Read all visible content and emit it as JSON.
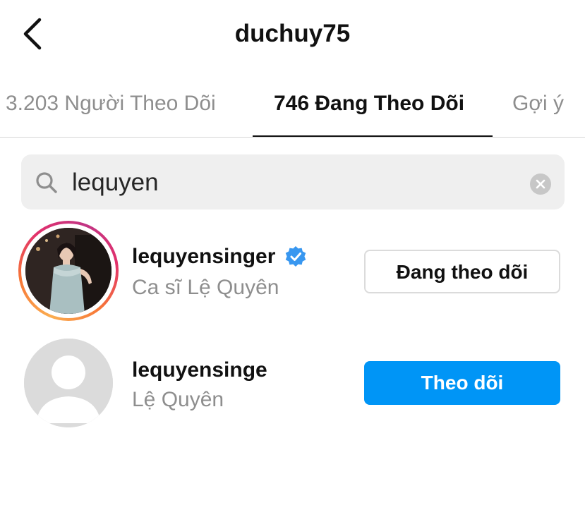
{
  "header": {
    "title": "duchuy75",
    "back_icon": "chevron-left-icon"
  },
  "tabs": [
    {
      "label": "3.203 Người Theo Dõi",
      "active": false
    },
    {
      "label": "746 Đang Theo Dõi",
      "active": true
    },
    {
      "label": "Gợi ý",
      "active": false
    }
  ],
  "search": {
    "value": "lequyen",
    "search_icon": "search-icon",
    "clear_icon": "clear-icon"
  },
  "results": [
    {
      "username": "lequyensinger",
      "fullname": "Ca sĩ Lệ Quyên",
      "verified": true,
      "has_story": true,
      "button_label": "Đang theo dõi"
    },
    {
      "username": "lequyensinge",
      "fullname": "Lệ Quyên",
      "verified": false,
      "has_story": false,
      "button_label": "Theo dõi"
    }
  ],
  "colors": {
    "accent": "#0095f6",
    "verified_badge": "#3897f0",
    "secondary_text": "#8e8e8e",
    "search_bg": "#efefef"
  }
}
